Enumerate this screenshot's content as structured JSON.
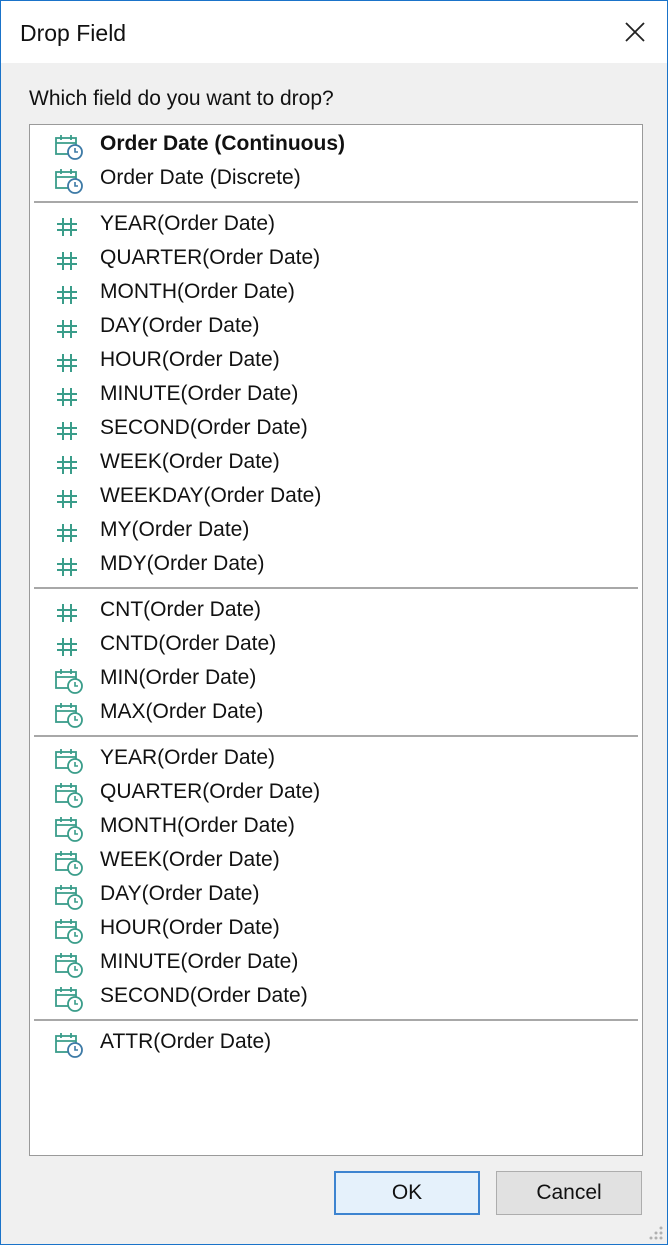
{
  "window": {
    "title": "Drop Field",
    "prompt": "Which field do you want to drop?"
  },
  "colors": {
    "accent_teal": "#3a9d8a",
    "date_icon_blue": "#3d7aa6",
    "window_border": "#1a73c9"
  },
  "groups": [
    {
      "items": [
        {
          "label": "Order Date (Continuous)",
          "icon": "calendar-clock-icon",
          "bold": true
        },
        {
          "label": "Order Date (Discrete)",
          "icon": "calendar-clock-icon",
          "bold": false
        }
      ]
    },
    {
      "items": [
        {
          "label": "YEAR(Order Date)",
          "icon": "hash-icon"
        },
        {
          "label": "QUARTER(Order Date)",
          "icon": "hash-icon"
        },
        {
          "label": "MONTH(Order Date)",
          "icon": "hash-icon"
        },
        {
          "label": "DAY(Order Date)",
          "icon": "hash-icon"
        },
        {
          "label": "HOUR(Order Date)",
          "icon": "hash-icon"
        },
        {
          "label": "MINUTE(Order Date)",
          "icon": "hash-icon"
        },
        {
          "label": "SECOND(Order Date)",
          "icon": "hash-icon"
        },
        {
          "label": "WEEK(Order Date)",
          "icon": "hash-icon"
        },
        {
          "label": "WEEKDAY(Order Date)",
          "icon": "hash-icon"
        },
        {
          "label": "MY(Order Date)",
          "icon": "hash-icon"
        },
        {
          "label": "MDY(Order Date)",
          "icon": "hash-icon"
        }
      ]
    },
    {
      "items": [
        {
          "label": "CNT(Order Date)",
          "icon": "hash-green-icon"
        },
        {
          "label": "CNTD(Order Date)",
          "icon": "hash-green-icon"
        },
        {
          "label": "MIN(Order Date)",
          "icon": "calendar-clock-green-icon"
        },
        {
          "label": "MAX(Order Date)",
          "icon": "calendar-clock-green-icon"
        }
      ]
    },
    {
      "items": [
        {
          "label": "YEAR(Order Date)",
          "icon": "calendar-clock-green-icon"
        },
        {
          "label": "QUARTER(Order Date)",
          "icon": "calendar-clock-green-icon"
        },
        {
          "label": "MONTH(Order Date)",
          "icon": "calendar-clock-green-icon"
        },
        {
          "label": "WEEK(Order Date)",
          "icon": "calendar-clock-green-icon"
        },
        {
          "label": "DAY(Order Date)",
          "icon": "calendar-clock-green-icon"
        },
        {
          "label": "HOUR(Order Date)",
          "icon": "calendar-clock-green-icon"
        },
        {
          "label": "MINUTE(Order Date)",
          "icon": "calendar-clock-green-icon"
        },
        {
          "label": "SECOND(Order Date)",
          "icon": "calendar-clock-green-icon"
        }
      ]
    },
    {
      "items": [
        {
          "label": "ATTR(Order Date)",
          "icon": "calendar-clock-icon"
        }
      ]
    }
  ],
  "buttons": {
    "ok": "OK",
    "cancel": "Cancel"
  }
}
